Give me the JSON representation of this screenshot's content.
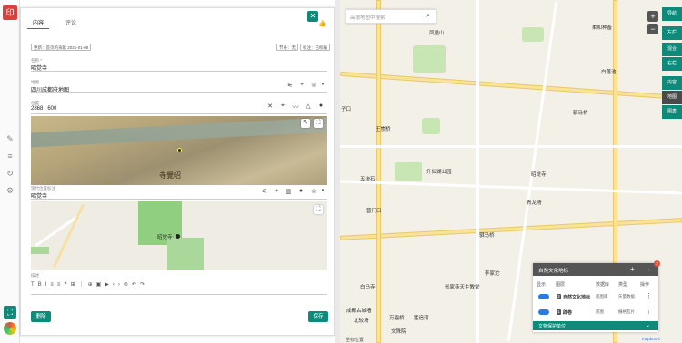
{
  "colors": {
    "accent": "#0e8a7a",
    "primary_blue": "#2a7ae2",
    "badge_red": "#e74c3c"
  },
  "left_sidebar": {
    "icons": [
      "pencil-icon",
      "list-icon",
      "history-icon",
      "settings-icon"
    ],
    "fullscreen_icon": "fullscreen-icon"
  },
  "editor": {
    "tabs": [
      {
        "label": "内容"
      },
      {
        "label": "评论"
      }
    ],
    "meta_left": "更新：首页的贡献 2021-01-08",
    "meta_right": [
      "节条：无",
      "标注：已校编"
    ],
    "fields": {
      "name": {
        "label": "名称 *",
        "value": "昭觉寺"
      },
      "map": {
        "label": "地图",
        "value": "四川成都府地图"
      },
      "position": {
        "label": "位置",
        "value": "2868 , 600"
      },
      "modern_location": {
        "label": "现代位置标注",
        "value": "昭觉寺"
      },
      "description": {
        "label": "描述"
      }
    },
    "map1_overlay_text": "寺覺昭",
    "map2_label": "昭觉寺",
    "buttons": {
      "delete": "删除",
      "save": "保存"
    }
  },
  "bigmap": {
    "search_placeholder": "高德地图中搜索",
    "right_buttons": [
      "导航",
      "左栏",
      "混合",
      "右栏",
      "内容",
      "地图",
      "图表"
    ],
    "places": [
      "凤凰山",
      "柔和种畜",
      "白莲池",
      "王崇桥",
      "升仙湖公园",
      "驷马桥",
      "五块石",
      "营门口",
      "昭觉寺",
      "青龙场",
      "驷马桥",
      "李家沱",
      "白马寺",
      "张家巷天主教堂",
      "成都古城墙",
      "北较场",
      "万福桥",
      "猛追湾",
      "文殊院",
      "子口"
    ],
    "bottom_label": "坐标位置",
    "attribution": "mapbox ©"
  },
  "layer_panel": {
    "title": "自然文化地标",
    "badge_count": "2",
    "columns": [
      "显示",
      "图层",
      "数据库",
      "类型",
      "操作"
    ],
    "rows": [
      {
        "num": "2",
        "name": "自然文化地标",
        "db": "底图库",
        "type": "矢量数据"
      },
      {
        "num": "1",
        "name": "辟卷",
        "db": "底图",
        "type": "栅格瓦片"
      }
    ],
    "footer": "文物保护单位"
  }
}
